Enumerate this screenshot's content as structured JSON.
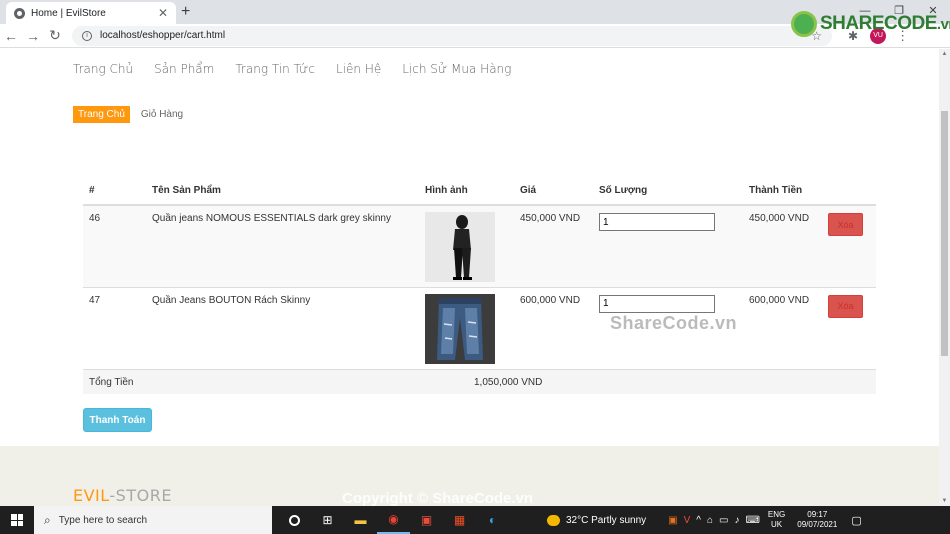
{
  "browser": {
    "tab_title": "Home | EvilStore",
    "url": "localhost/eshopper/cart.html",
    "profile": "VU"
  },
  "sharecode": {
    "brand": "SHARECODE",
    "tld": ".vn",
    "watermark": "ShareCode.vn",
    "copyright": "Copyright © ShareCode.vn"
  },
  "nav": [
    "Trang Chủ",
    "Sản Phẩm",
    "Trang Tin Tức",
    "Liên Hệ",
    "Lịch Sử Mua Hàng"
  ],
  "breadcrumb": {
    "active": "Trang Chủ",
    "current": "Giỏ Hàng"
  },
  "cart": {
    "headers": [
      "#",
      "Tên Sản Phẩm",
      "Hình ảnh",
      "Giá",
      "Số Lượng",
      "Thành Tiền",
      ""
    ],
    "items": [
      {
        "id": "46",
        "name": "Quần jeans NOMOUS ESSENTIALS dark grey skinny",
        "price": "450,000 VND",
        "qty": "1",
        "subtotal": "450,000 VND",
        "delete": "Xóa"
      },
      {
        "id": "47",
        "name": "Quần Jeans BOUTON Rách Skinny",
        "price": "600,000 VND",
        "qty": "1",
        "subtotal": "600,000 VND",
        "delete": "Xóa"
      }
    ],
    "total_label": "Tổng Tiền",
    "total_value": "1,050,000 VND",
    "checkout": "Thanh Toán"
  },
  "footer": {
    "logo_a": "EVIL",
    "logo_b": "-STORE"
  },
  "taskbar": {
    "search": "Type here to search",
    "weather": "32°C  Partly sunny",
    "lang1": "ENG",
    "lang2": "UK",
    "time": "09:17",
    "date": "09/07/2021"
  }
}
